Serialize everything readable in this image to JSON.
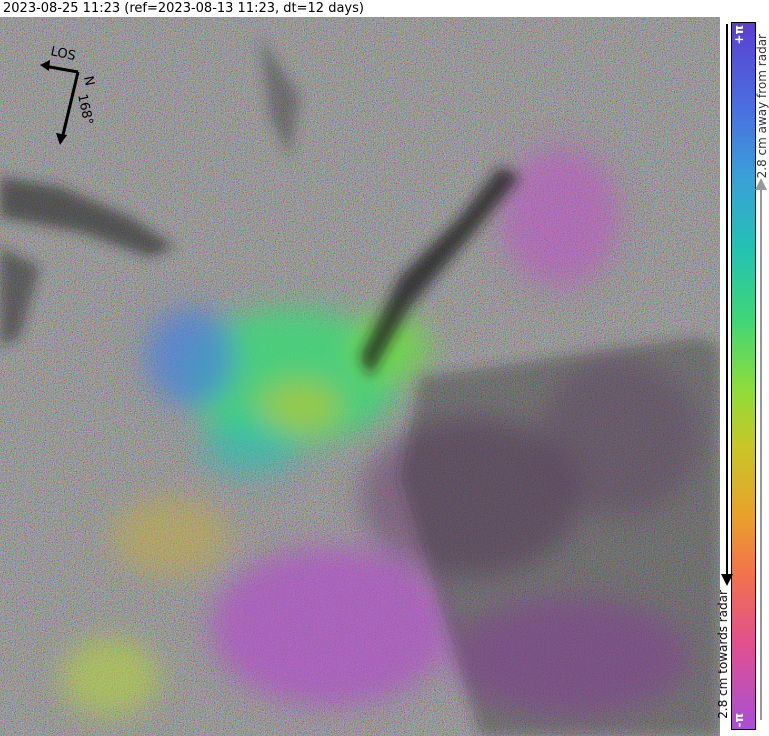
{
  "title": "2023-08-25 11:23 (ref=2023-08-13 11:23, dt=12 days)",
  "compass": {
    "los_label": "LOS",
    "north_label": "N",
    "angle_label": "168°"
  },
  "colorbar": {
    "top_label": "+π",
    "bottom_label": "-π",
    "away_label": "2.8 cm away from radar",
    "towards_label": "2.8 cm towards radar"
  },
  "colors": {
    "away": "#5b3fd0",
    "green_patch": "#3fd677",
    "magenta_patch": "#b04fc8",
    "terrain": "#6f6f6f"
  }
}
